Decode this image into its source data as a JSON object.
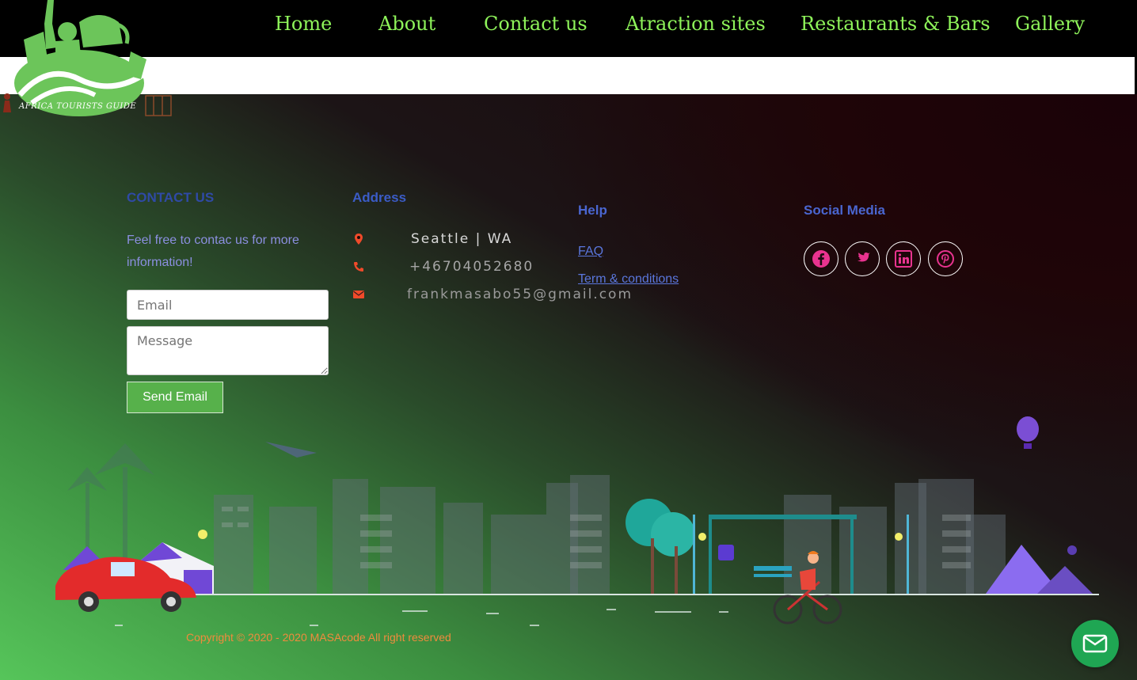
{
  "nav": {
    "items": [
      {
        "label": "Home"
      },
      {
        "label": "About"
      },
      {
        "label": "Contact us"
      },
      {
        "label": "Atraction sites"
      },
      {
        "label": "Restaurants & Bars"
      },
      {
        "label": "Gallery"
      }
    ]
  },
  "logo": {
    "text": "AFRICA TOURISTS GUIDE"
  },
  "colors": {
    "nav_text": "#8ef35a",
    "send_button": "#57b14b",
    "icons": "#f04a2a",
    "social": "#e8338f",
    "fab": "#1fa653"
  },
  "contact": {
    "title": "CONTACT US",
    "text": "Feel free to contac us for more information!",
    "email_placeholder": "Email",
    "message_placeholder": "Message",
    "send_label": "Send Email"
  },
  "address": {
    "title": "Address",
    "location": "Seattle | WA",
    "phone": "+46704052680",
    "email": "frankmasabo55@gmail.com",
    "icons": [
      "map-marker-icon",
      "phone-icon",
      "envelope-icon"
    ]
  },
  "help": {
    "title": "Help",
    "links": [
      {
        "label": "FAQ"
      },
      {
        "label": "Term & conditions"
      }
    ]
  },
  "social": {
    "title": "Social Media",
    "items": [
      "facebook-icon",
      "twitter-icon",
      "linkedin-icon",
      "pinterest-icon"
    ]
  },
  "footer": {
    "copyright": "Copyright © 2020 - 2020 MASAcode All right reserved"
  },
  "fab": {
    "icon": "mail-icon"
  }
}
